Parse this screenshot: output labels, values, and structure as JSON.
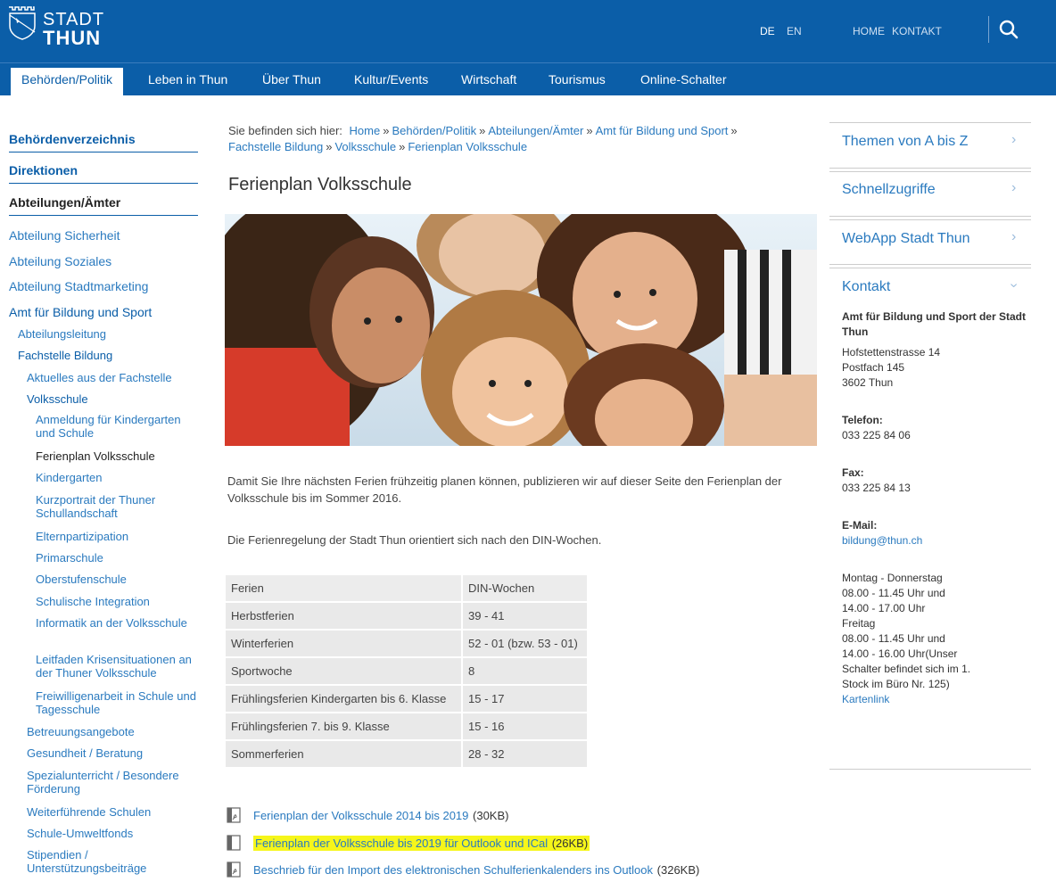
{
  "header": {
    "logo_stadt": "STADT",
    "logo_thun": "THUN",
    "lang_de": "DE",
    "lang_en": "EN",
    "home": "HOME",
    "kontakt": "KONTAKT",
    "search_icon": "search-icon"
  },
  "nav": [
    "Behörden/Politik",
    "Leben in Thun",
    "Über Thun",
    "Kultur/Events",
    "Wirtschaft",
    "Tourismus",
    "Online-Schalter"
  ],
  "sidebar": {
    "h1": "Behördenverzeichnis",
    "h2": "Direktionen",
    "h3": "Abteilungen/Ämter",
    "l1": [
      "Abteilung Sicherheit",
      "Abteilung Soziales",
      "Abteilung Stadtmarketing",
      "Amt für Bildung und Sport"
    ],
    "l2": [
      "Abteilungsleitung",
      "Fachstelle Bildung"
    ],
    "l3a": [
      "Aktuelles aus der Fachstelle",
      "Volksschule"
    ],
    "l4": [
      "Anmeldung für Kindergarten und Schule",
      "Ferienplan Volksschule",
      "Kindergarten",
      "Kurzportrait der Thuner Schullandschaft",
      "Elternpartizipation",
      "Primarschule",
      "Oberstufenschule",
      "Schulische Integration",
      "Informatik an der Volksschule",
      "Leitfaden Krisensituationen an der Thuner Volksschule",
      "Freiwilligenarbeit in Schule und Tagesschule"
    ],
    "l3b": [
      "Betreuungsangebote",
      "Gesundheit / Beratung",
      "Spezialunterricht / Besondere Förderung",
      "Weiterführende Schulen",
      "Schule-Umweltfonds",
      "Stipendien / Unterstützungsbeiträge"
    ]
  },
  "breadcrumb": {
    "prefix": "Sie befinden sich hier:",
    "items": [
      "Home",
      "Behörden/Politik",
      "Abteilungen/Ämter",
      "Amt für Bildung und Sport",
      "Fachstelle Bildung",
      "Volksschule",
      "Ferienplan Volksschule"
    ],
    "sep": "»"
  },
  "main": {
    "title": "Ferienplan Volksschule",
    "para1": "Damit Sie Ihre nächsten Ferien frühzeitig planen können, publizieren wir auf dieser Seite den Ferienplan der Volksschule bis im Sommer 2016.",
    "para2": "Die Ferienregelung der Stadt Thun orientiert sich nach den DIN-Wochen.",
    "table": {
      "headers": [
        "Ferien",
        "DIN-Wochen"
      ],
      "rows": [
        [
          "Herbstferien",
          "39 - 41"
        ],
        [
          "Winterferien",
          "52 - 01 (bzw. 53 - 01)"
        ],
        [
          "Sportwoche",
          "8"
        ],
        [
          "Frühlingsferien Kindergarten bis 6. Klasse",
          "15 - 17"
        ],
        [
          "Frühlingsferien 7. bis 9. Klasse",
          "15 - 16"
        ],
        [
          "Sommerferien",
          "28 - 32"
        ]
      ]
    },
    "downloads": [
      {
        "label": "Ferienplan der Volksschule 2014 bis 2019",
        "size": "(30KB)",
        "icon": "pdf-icon"
      },
      {
        "label": "Ferienplan der Volksschule bis 2019 für Outlook und ICal",
        "size": "(26KB)",
        "icon": "file-icon"
      },
      {
        "label": "Beschrieb für den Import des elektronischen Schulferienkalenders ins Outlook",
        "size": "(326KB)",
        "icon": "pdf-icon"
      }
    ]
  },
  "right": {
    "links": [
      "Themen von A bis Z",
      "Schnellzugriffe",
      "WebApp Stadt Thun"
    ],
    "kontakt_label": "Kontakt",
    "org": "Amt für Bildung und Sport der Stadt Thun",
    "address": [
      "Hofstettenstrasse 14",
      "Postfach 145",
      "3602 Thun"
    ],
    "telefon_label": "Telefon:",
    "telefon": "033 225 84 06",
    "fax_label": "Fax:",
    "fax": "033 225 84 13",
    "email_label": "E-Mail:",
    "email": "bildung@thun.ch",
    "hours": [
      "Montag - Donnerstag",
      "08.00 - 11.45 Uhr und",
      "14.00 - 17.00 Uhr",
      "Freitag",
      "08.00 - 11.45 Uhr und",
      "14.00 - 16.00 Uhr(Unser",
      "Schalter befindet sich im 1.",
      "Stock im Büro Nr. 125)"
    ],
    "kartenlink": "Kartenlink"
  }
}
